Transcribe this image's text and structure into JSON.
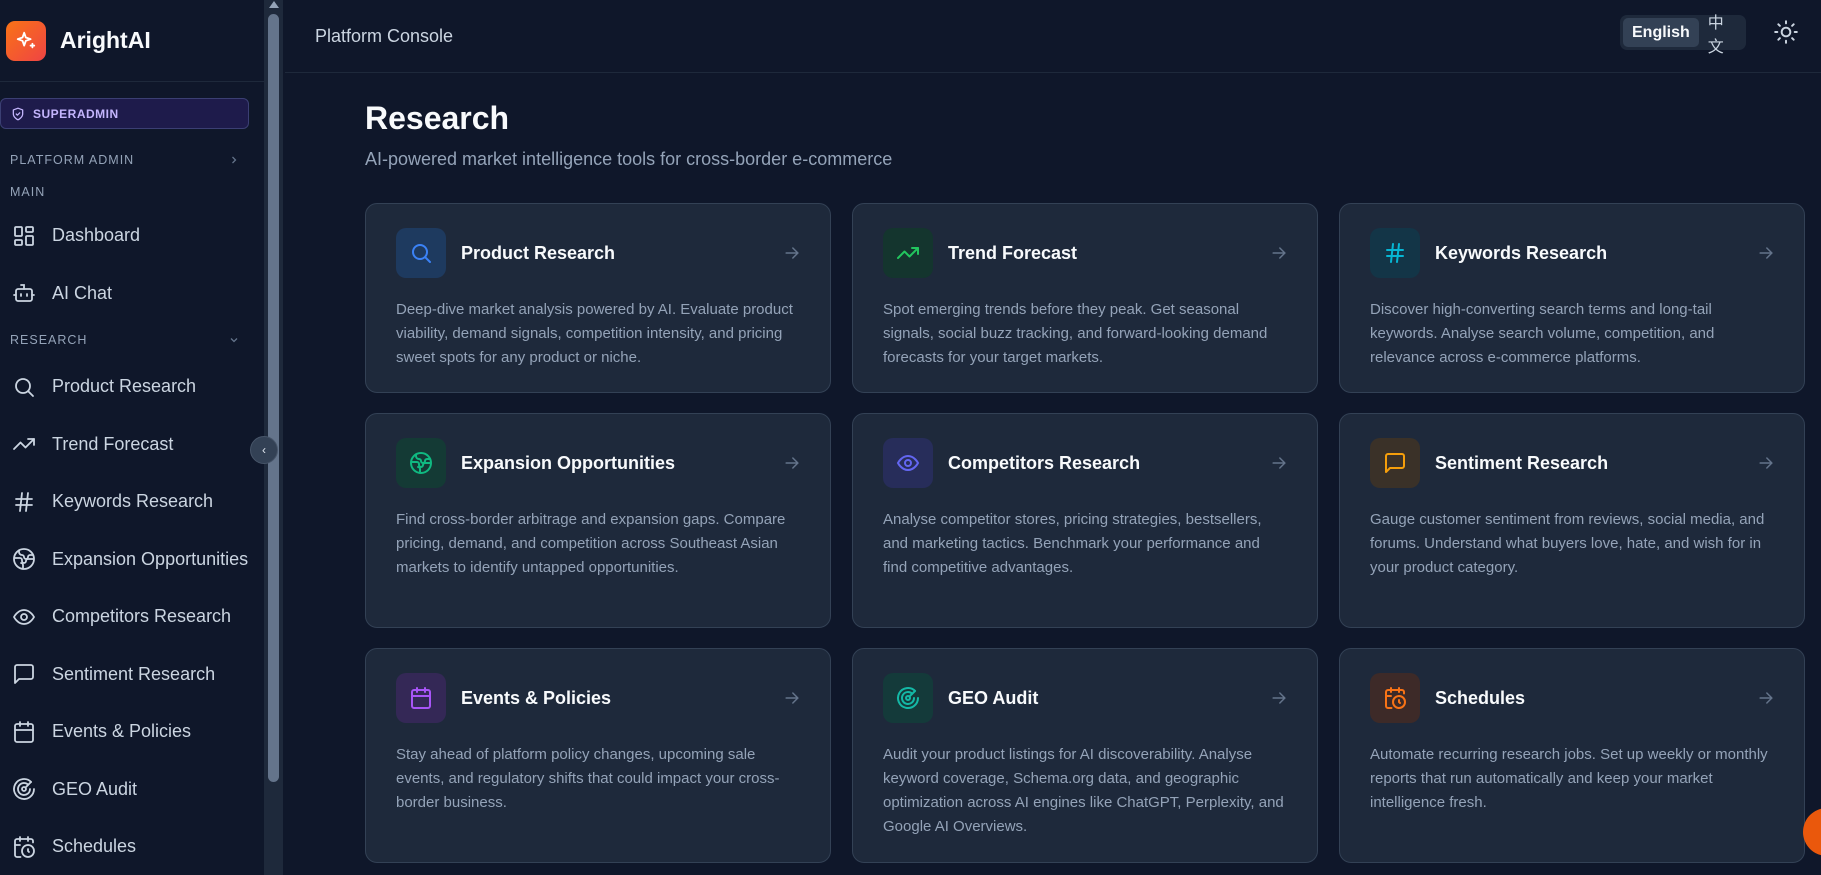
{
  "brand": {
    "name": "ArightAI"
  },
  "role": {
    "badge": "SUPERADMIN"
  },
  "sidebar": {
    "platform_admin": "PLATFORM ADMIN",
    "main_label": "MAIN",
    "main_items": [
      {
        "label": "Dashboard",
        "icon": "dashboard-icon"
      },
      {
        "label": "AI Chat",
        "icon": "bot-icon"
      }
    ],
    "research_label": "RESEARCH",
    "research_items": [
      {
        "label": "Product Research",
        "icon": "search-icon"
      },
      {
        "label": "Trend Forecast",
        "icon": "trend-icon"
      },
      {
        "label": "Keywords Research",
        "icon": "hash-icon"
      },
      {
        "label": "Expansion Opportunities",
        "icon": "globe-icon"
      },
      {
        "label": "Competitors Research",
        "icon": "eye-icon"
      },
      {
        "label": "Sentiment Research",
        "icon": "message-icon"
      },
      {
        "label": "Events & Policies",
        "icon": "calendar-icon"
      },
      {
        "label": "GEO Audit",
        "icon": "radar-icon"
      },
      {
        "label": "Schedules",
        "icon": "calendar-clock-icon"
      }
    ]
  },
  "header": {
    "title": "Platform Console",
    "languages": [
      "English",
      "中文"
    ],
    "active_language": "English"
  },
  "page": {
    "title": "Research",
    "subtitle": "AI-powered market intelligence tools for cross-border e-commerce"
  },
  "cards": [
    {
      "title": "Product Research",
      "icon": "search-icon",
      "color": "#3b82f6",
      "bg": "#1e3a5f",
      "desc": "Deep-dive market analysis powered by AI. Evaluate product viability, demand signals, competition intensity, and pricing sweet spots for any product or niche."
    },
    {
      "title": "Trend Forecast",
      "icon": "trend-icon",
      "color": "#22c55e",
      "bg": "#14352e",
      "desc": "Spot emerging trends before they peak. Get seasonal signals, social buzz tracking, and forward-looking demand forecasts for your target markets."
    },
    {
      "title": "Keywords Research",
      "icon": "hash-icon",
      "color": "#06b6d4",
      "bg": "#133547",
      "desc": "Discover high-converting search terms and long-tail keywords. Analyse search volume, competition, and relevance across e-commerce platforms."
    },
    {
      "title": "Expansion Opportunities",
      "icon": "globe-icon",
      "color": "#10b981",
      "bg": "#143a35",
      "desc": "Find cross-border arbitrage and expansion gaps. Compare pricing, demand, and competition across Southeast Asian markets to identify untapped opportunities."
    },
    {
      "title": "Competitors Research",
      "icon": "eye-icon",
      "color": "#6366f1",
      "bg": "#272d5a",
      "desc": "Analyse competitor stores, pricing strategies, bestsellers, and marketing tactics. Benchmark your performance and find competitive advantages."
    },
    {
      "title": "Sentiment Research",
      "icon": "message-icon",
      "color": "#f59e0b",
      "bg": "#3a3128",
      "desc": "Gauge customer sentiment from reviews, social media, and forums. Understand what buyers love, hate, and wish for in your product category."
    },
    {
      "title": "Events & Policies",
      "icon": "calendar-icon",
      "color": "#a855f7",
      "bg": "#342856",
      "desc": "Stay ahead of platform policy changes, upcoming sale events, and regulatory shifts that could impact your cross-border business."
    },
    {
      "title": "GEO Audit",
      "icon": "radar-icon",
      "color": "#14b8a6",
      "bg": "#143a3a",
      "desc": "Audit your product listings for AI discoverability. Analyse keyword coverage, Schema.org data, and geographic optimization across AI engines like ChatGPT, Perplexity, and Google AI Overviews."
    },
    {
      "title": "Schedules",
      "icon": "calendar-clock-icon",
      "color": "#f97316",
      "bg": "#3d2a28",
      "desc": "Automate recurring research jobs. Set up weekly or monthly reports that run automatically and keep your market intelligence fresh."
    }
  ]
}
